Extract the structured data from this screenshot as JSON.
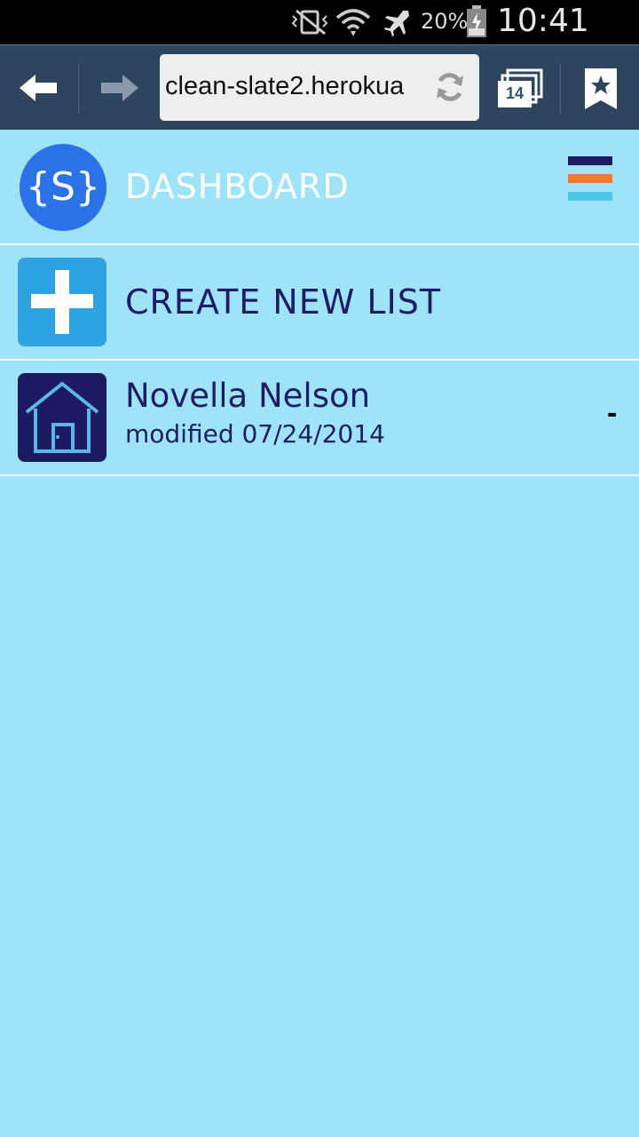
{
  "status_bar": {
    "battery": "20%",
    "time": "10:41 AM",
    "icons": [
      "vibrate-mute-icon",
      "wifi-icon",
      "airplane-icon",
      "battery-icon"
    ]
  },
  "browser": {
    "url": "clean-slate2.herokua",
    "tab_count": "14",
    "icons": [
      "back-arrow-icon",
      "forward-arrow-icon",
      "reload-icon",
      "tabs-icon",
      "bookmark-icon"
    ]
  },
  "header": {
    "logo_text": "{S}",
    "title": "DASHBOARD",
    "menu_colors": [
      "#1c1b62",
      "#f07a2e",
      "#4fc7e8"
    ]
  },
  "create": {
    "label": "CREATE NEW LIST"
  },
  "lists": [
    {
      "name": "Novella Nelson",
      "modified": "modified 07/24/2014",
      "action": "-"
    }
  ],
  "colors": {
    "background": "#9fe3f8",
    "accent_blue": "#2b72e6",
    "navy": "#1c1b62",
    "toolbar": "#2e4560"
  }
}
